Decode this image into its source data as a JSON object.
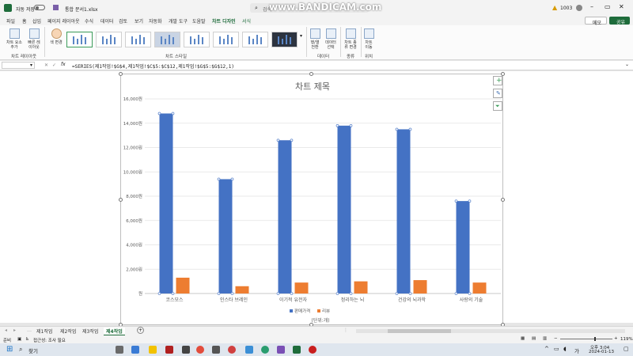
{
  "titlebar": {
    "autosave": "자동 저장",
    "autosave_state": "끔",
    "filename": "통합 문서1.xlsx",
    "search_placeholder": "검색",
    "watermark": "www.BANDICAM.com",
    "warning_count": "1003"
  },
  "menu_tabs": [
    "파일",
    "홈",
    "삽입",
    "페이지 레이아웃",
    "수식",
    "데이터",
    "검토",
    "보기",
    "자동화",
    "개발 도구",
    "도움말",
    "차트 디자인",
    "서식"
  ],
  "active_tab": "차트 디자인",
  "top_right": {
    "memo": "메모",
    "share": "공유"
  },
  "ribbon": {
    "add_element": "차트 요소\n추가",
    "quick_layout": "빠른 레\n이아웃",
    "change_colors": "색 변경",
    "group_layout": "차트 레이아웃",
    "group_styles": "차트 스타일",
    "switch_row_col": "행/열\n전환",
    "select_data": "데이터\n선택",
    "group_data": "데이터",
    "change_type": "차트 종\n류 변경",
    "group_type": "종류",
    "move_chart": "차트\n이동",
    "group_location": "위치"
  },
  "formula_bar": {
    "name_box": "",
    "fx": "fx",
    "formula": "=SERIES(제1작업!$G$4,제1작업!$C$5:$C$12,제1작업!$G$5:$G$12,1)"
  },
  "chart_data": {
    "type": "bar",
    "title": "차트 제목",
    "categories": [
      "코스모스",
      "인스타 브레인",
      "이기적 유전자",
      "정리하는 뇌",
      "건강의 뇌과학",
      "사랑의 기술"
    ],
    "series": [
      {
        "name": "판매가격",
        "color": "#4472c4",
        "values": [
          14800,
          9400,
          12600,
          13800,
          13500,
          7600
        ]
      },
      {
        "name": "리뷰",
        "color": "#ed7d31",
        "values": [
          1300,
          600,
          900,
          1000,
          1100,
          900
        ]
      }
    ],
    "ylim": [
      0,
      16000
    ],
    "yticks": [
      "원",
      "2,000원",
      "4,000원",
      "6,000원",
      "8,000원",
      "10,000원",
      "12,000원",
      "14,000원",
      "16,000원"
    ],
    "footnote": "(단위:개)",
    "legend_position": "bottom",
    "grid": true
  },
  "sheet_tabs": [
    "제1작업",
    "제2작업",
    "제3작업",
    "제4작업"
  ],
  "active_sheet": "제4작업",
  "status": {
    "ready": "준비",
    "accessibility": "접근성: 조사 필요",
    "zoom": "119%"
  },
  "taskbar": {
    "search": "찾기",
    "time": "오후 3:04",
    "date": "2024-01-13",
    "ime": "가"
  }
}
